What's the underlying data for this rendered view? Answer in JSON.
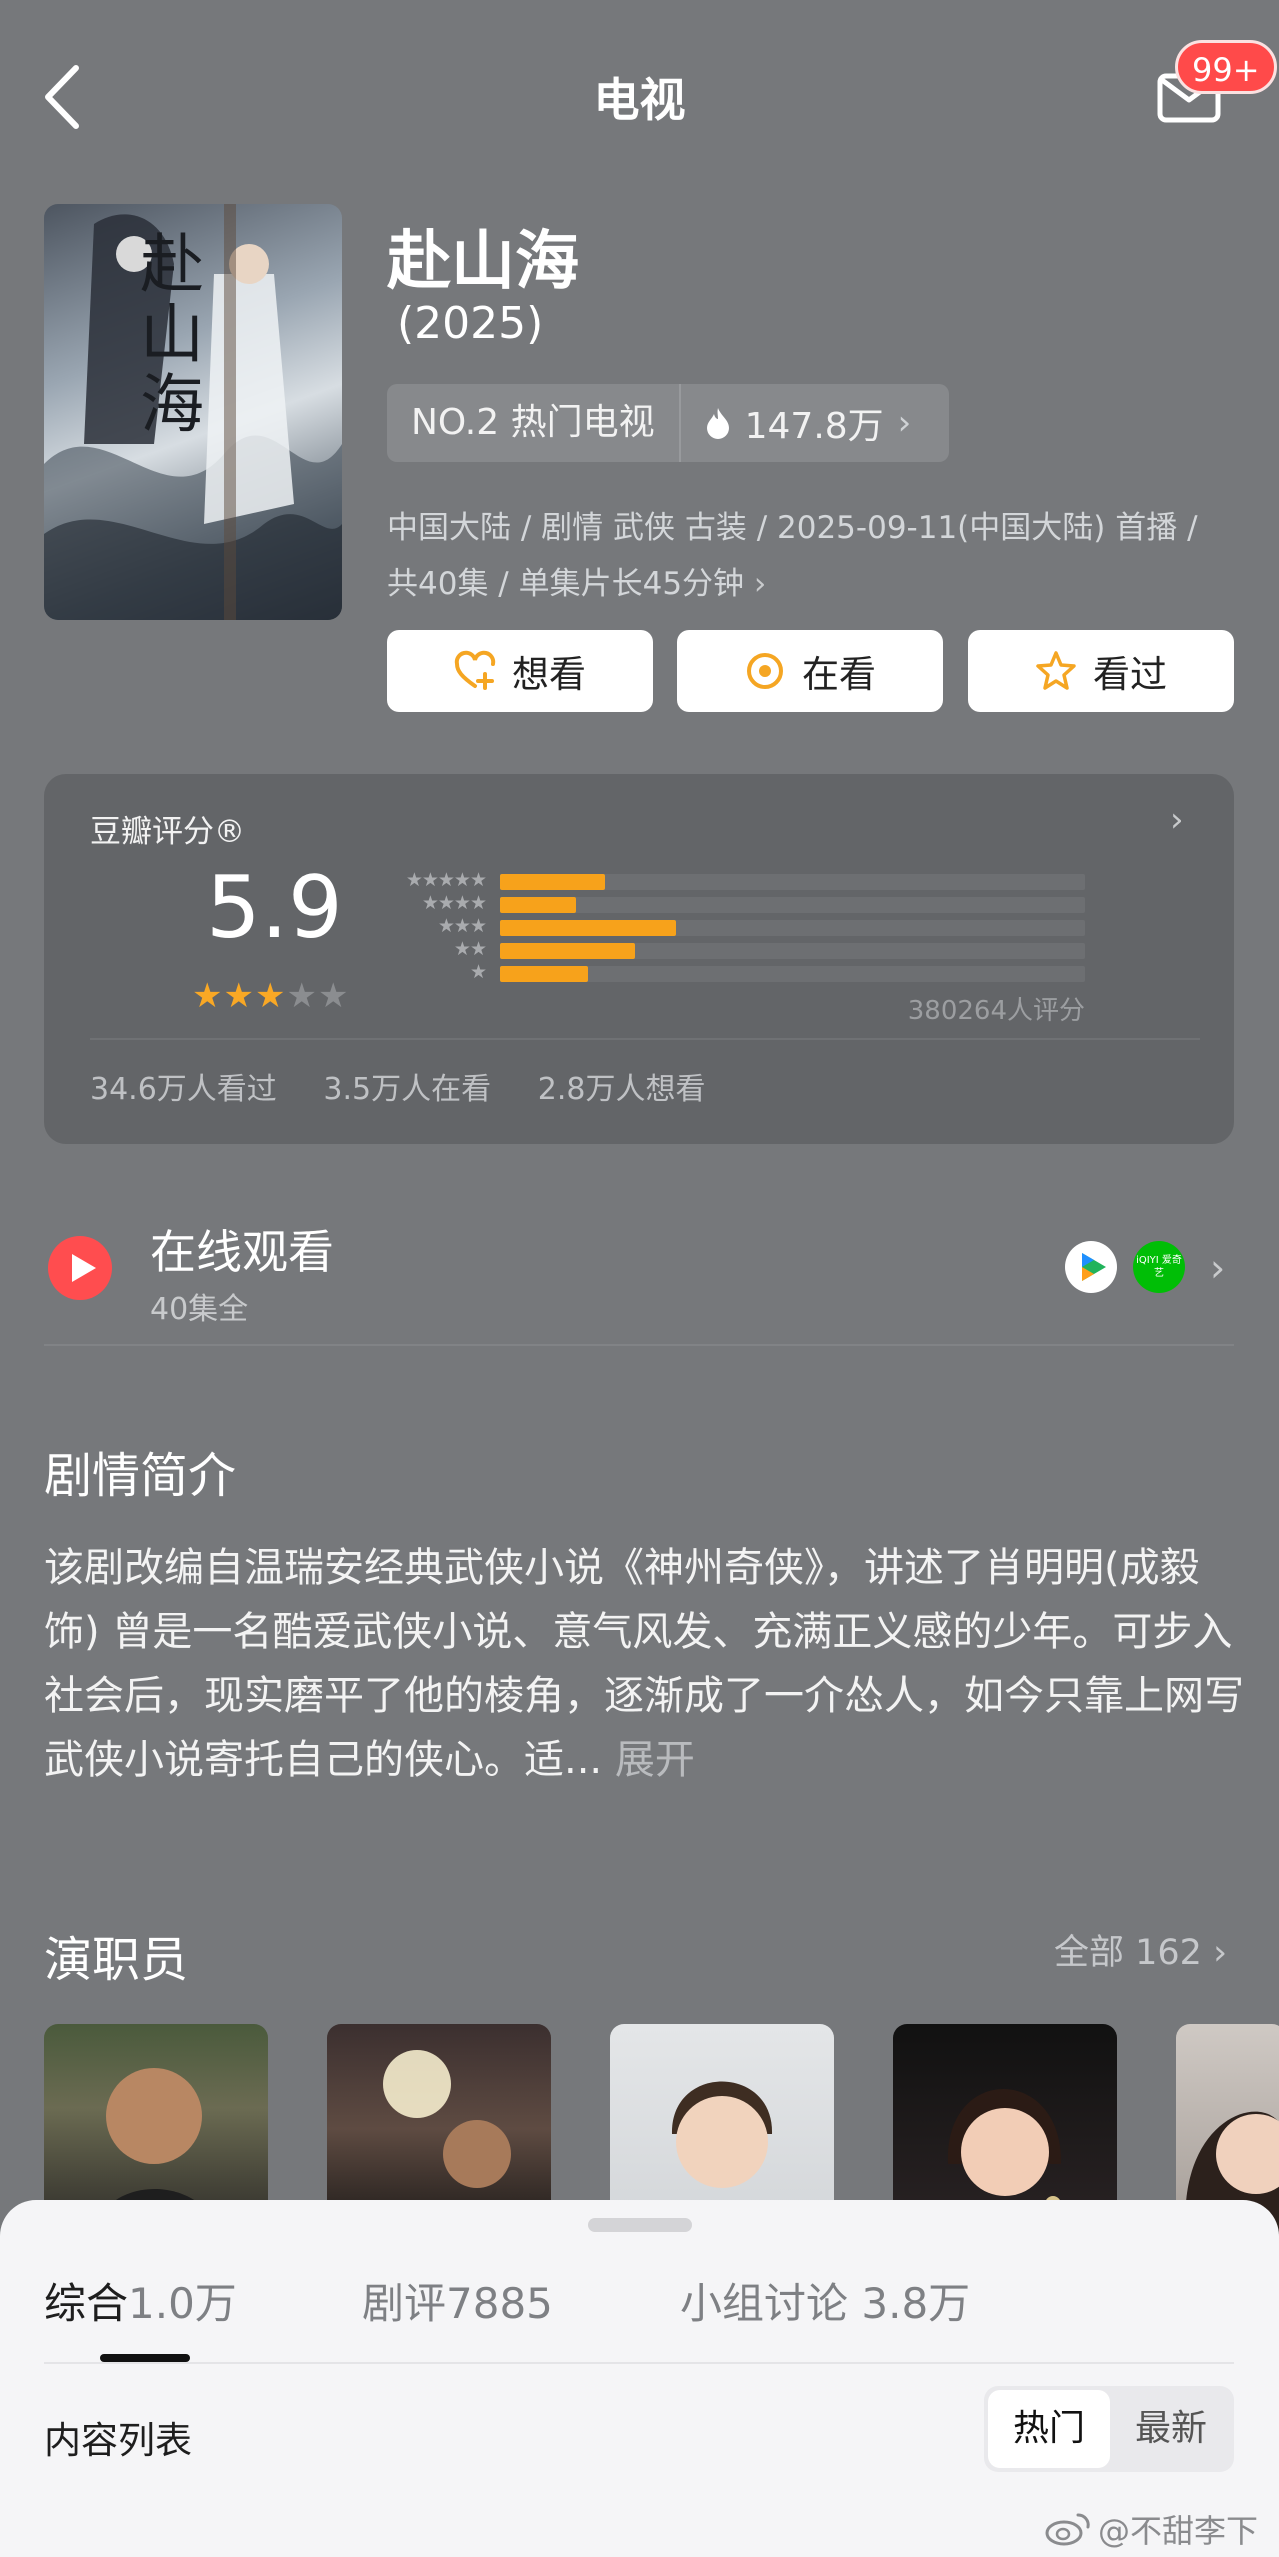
{
  "header": {
    "title": "电视",
    "badge": "99+"
  },
  "show": {
    "poster_title": "赴山海",
    "title": "赴山海",
    "year": "(2025)",
    "rank": "NO.2 热门电视",
    "heat": "147.8万",
    "meta_line1": "中国大陆 / 剧情 武侠 古装 / 2025-09-11(中国大陆) 首播 /",
    "meta_line2": "共40集 / 单集片长45分钟",
    "actions": [
      "想看",
      "在看",
      "看过"
    ]
  },
  "rating": {
    "label": "豆瓣评分®",
    "score": "5.9",
    "stars_filled": 3,
    "stars_total": 5,
    "votes": "380264人评分",
    "distribution": [
      {
        "stars": "★★★★★",
        "fraction": 0.18
      },
      {
        "stars": "★★★★",
        "fraction": 0.13
      },
      {
        "stars": "★★★",
        "fraction": 0.3
      },
      {
        "stars": "★★",
        "fraction": 0.23
      },
      {
        "stars": "★",
        "fraction": 0.15
      }
    ],
    "watched": "34.6万人看过",
    "watching": "3.5万人在看",
    "want": "2.8万人想看"
  },
  "online": {
    "title": "在线观看",
    "subtitle": "40集全",
    "platform2_label": "iQIYI 爱奇艺"
  },
  "synopsis": {
    "title": "剧情简介",
    "text": "该剧改编自温瑞安经典武侠小说《神州奇侠》，讲述了肖明明(成毅 饰) 曾是一名酷爱武侠小说、意气风发、充满正义感的少年。可步入社会后，现实磨平了他的棱角，逐渐成了一介怂人，如今只靠上网写武侠小说寄托自己的侠心。适...",
    "expand": "展开"
  },
  "cast": {
    "title": "演职员",
    "all_label": "全部 162"
  },
  "sheet": {
    "tabs": [
      {
        "label": "综合",
        "count": "1.0万"
      },
      {
        "label": "剧评",
        "count": "7885"
      },
      {
        "label": "小组讨论",
        "count": "3.8万"
      }
    ],
    "list_label": "内容列表",
    "sort_hot": "热门",
    "sort_new": "最新"
  },
  "watermark": "@不甜李下",
  "colors": {
    "accent_orange": "#f7a21b",
    "badge_red": "#ff4a4a",
    "play_red": "#ff4d4f"
  }
}
